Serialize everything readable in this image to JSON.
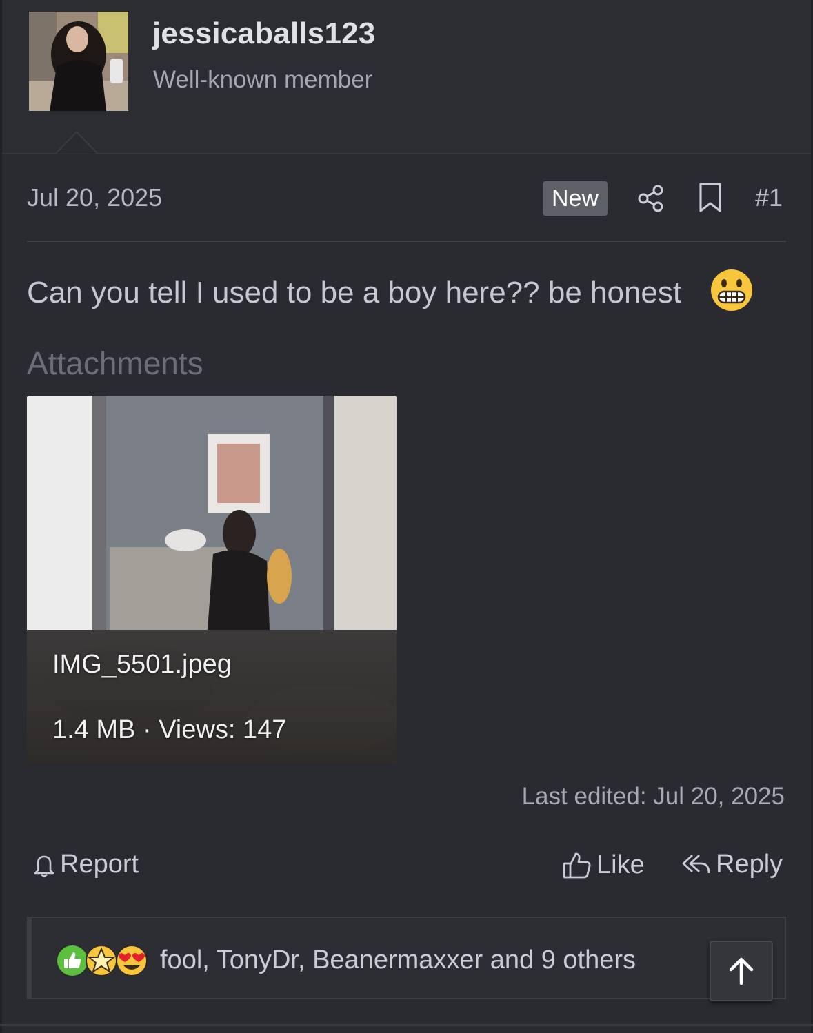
{
  "user": {
    "username": "jessicaballs123",
    "title": "Well-known member"
  },
  "post": {
    "date": "Jul 20, 2025",
    "badge": "New",
    "number": "#1",
    "message": "Can you tell I used to be a boy here?? be honest",
    "message_emoji": "grimacing-face-emoji",
    "last_edited": "Last edited: Jul 20, 2025"
  },
  "attachments": {
    "heading": "Attachments",
    "items": [
      {
        "file_name": "IMG_5501.jpeg",
        "meta": "1.4 MB · Views: 147"
      }
    ]
  },
  "actions": {
    "report": "Report",
    "like": "Like",
    "reply": "Reply"
  },
  "reactions": {
    "icons": [
      "thumbs-up-icon",
      "star-struck-icon",
      "heart-eyes-icon"
    ],
    "text": "fool, TonyDr, Beanermaxxer and 9 others"
  },
  "colors": {
    "background": "#2a2b30",
    "badge": "#5d6066",
    "accent_green": "#4caf50"
  }
}
